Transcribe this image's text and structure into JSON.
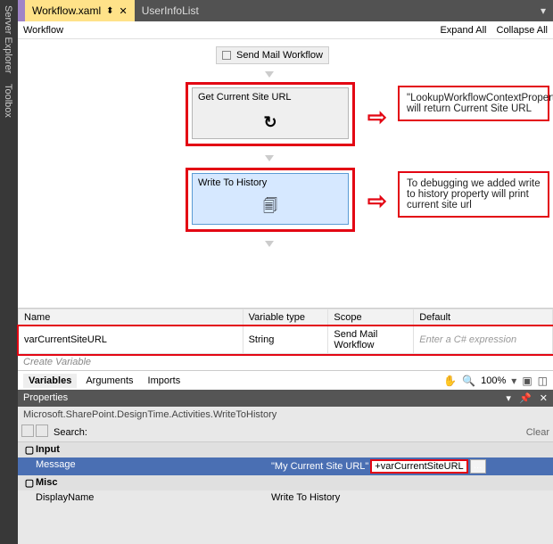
{
  "sidebar": {
    "tab1": "Server Explorer",
    "tab2": "Toolbox"
  },
  "doctabs": {
    "active": "Workflow.xaml",
    "inactive": "UserInfoList"
  },
  "breadcrumb": {
    "path": "Workflow",
    "expand": "Expand All",
    "collapse": "Collapse All"
  },
  "activities": {
    "sequence": "Send Mail Workflow",
    "a1": "Get Current Site URL",
    "a2": "Write To History"
  },
  "annotations": {
    "a1": "\"LookupWorkflowContextProperty\" will return Current Site URL",
    "a2": "To debugging we added write to history property will print current site url"
  },
  "variables": {
    "headers": {
      "name": "Name",
      "type": "Variable type",
      "scope": "Scope",
      "default": "Default"
    },
    "row": {
      "name": "varCurrentSiteURL",
      "type": "String",
      "scope": "Send Mail Workflow"
    },
    "default_placeholder": "Enter a C# expression",
    "create": "Create Variable"
  },
  "bottombar": {
    "t1": "Variables",
    "t2": "Arguments",
    "t3": "Imports",
    "zoom": "100%"
  },
  "properties": {
    "title": "Properties",
    "type": "Microsoft.SharePoint.DesignTime.Activities.WriteToHistory",
    "search_label": "Search:",
    "clear": "Clear",
    "cat_input": "Input",
    "msg_name": "Message",
    "msg_val_left": "\"My Current Site URL\"",
    "msg_val_right": "+varCurrentSiteURL",
    "cat_misc": "Misc",
    "dn_name": "DisplayName",
    "dn_val": "Write To History"
  }
}
